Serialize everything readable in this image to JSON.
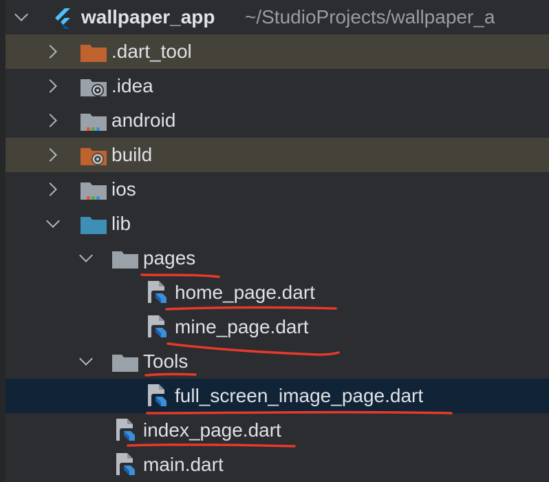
{
  "project": {
    "name": "wallpaper_app",
    "path": "~/StudioProjects/wallpaper_a"
  },
  "tree": [
    {
      "label": ".dart_tool",
      "kind": "folder-excluded",
      "expanded": false
    },
    {
      "label": ".idea",
      "kind": "folder-idea",
      "expanded": false
    },
    {
      "label": "android",
      "kind": "folder-module",
      "expanded": false
    },
    {
      "label": "build",
      "kind": "folder-excluded-idea",
      "expanded": false
    },
    {
      "label": "ios",
      "kind": "folder-module",
      "expanded": false
    },
    {
      "label": "lib",
      "kind": "folder-source",
      "expanded": true
    },
    {
      "label": "pages",
      "kind": "folder",
      "expanded": true
    },
    {
      "label": "home_page.dart",
      "kind": "dart-file"
    },
    {
      "label": "mine_page.dart",
      "kind": "dart-file"
    },
    {
      "label": "Tools",
      "kind": "folder",
      "expanded": true
    },
    {
      "label": "full_screen_image_page.dart",
      "kind": "dart-file",
      "selected": true
    },
    {
      "label": "index_page.dart",
      "kind": "dart-file"
    },
    {
      "label": "main.dart",
      "kind": "dart-file"
    }
  ],
  "colors": {
    "background": "#2b2d30",
    "excluded_row": "#45423a",
    "selected_row": "#112437",
    "excluded_folder": "#c0622e",
    "source_folder": "#3d8fb5",
    "plain_folder": "#9aa1a8",
    "annotation": "#e53a2a"
  },
  "annotations": {
    "type": "hand-drawn red underlines",
    "underlined_items": [
      "pages",
      "home_page.dart",
      "mine_page.dart",
      "Tools",
      "full_screen_image_page.dart",
      "index_page.dart"
    ]
  }
}
